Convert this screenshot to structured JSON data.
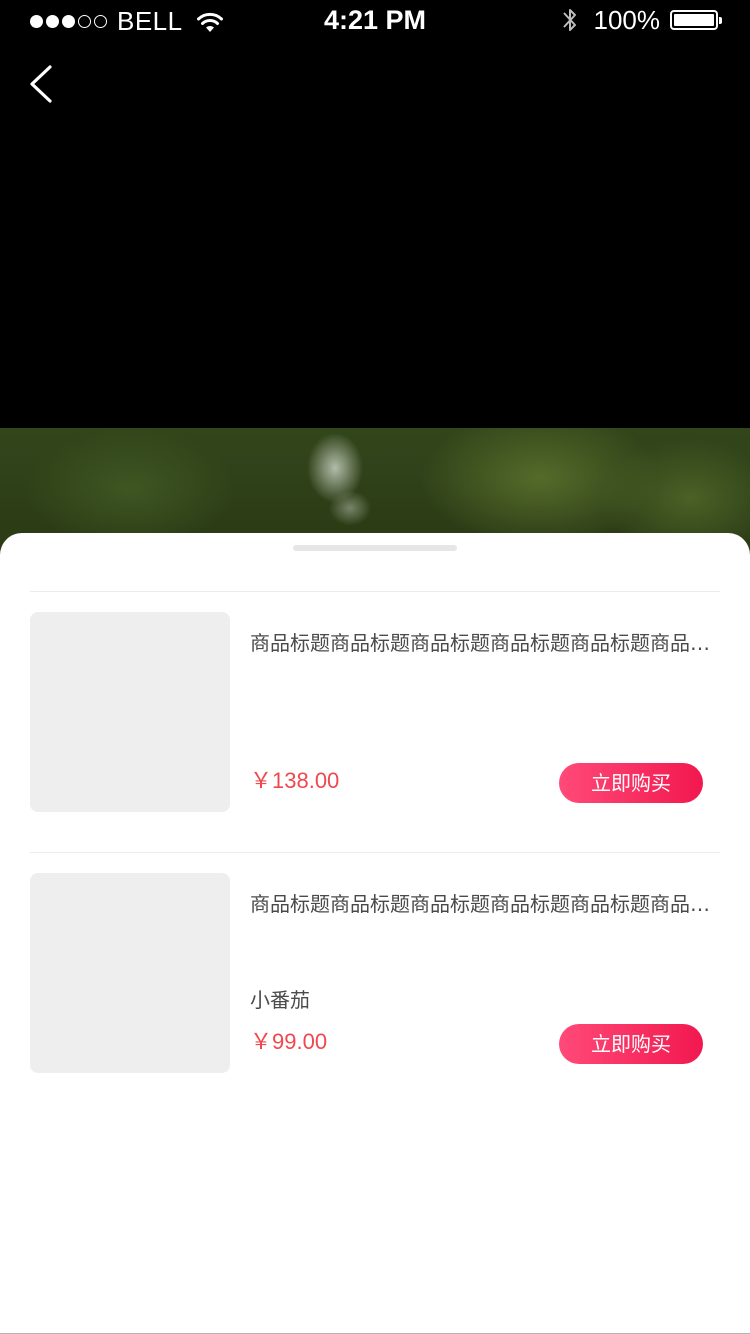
{
  "status_bar": {
    "carrier": "BELL",
    "time": "4:21 PM",
    "battery": "100%",
    "signal_bars_filled": 3,
    "signal_bars_total": 5
  },
  "navigation": {
    "back_icon": "chevron-left-icon"
  },
  "products": [
    {
      "title": "商品标题商品标题商品标题商品标题商品标题商品标题",
      "tag": "",
      "price": "￥138.00",
      "buy_label": "立即购买"
    },
    {
      "title": "商品标题商品标题商品标题商品标题商品标题商品标题",
      "tag": "小番茄",
      "price": "￥99.00",
      "buy_label": "立即购买"
    }
  ],
  "colors": {
    "price": "#f0484f",
    "button_start": "#ff4a78",
    "button_end": "#f2184f",
    "thumb_placeholder": "#eeeeee"
  }
}
